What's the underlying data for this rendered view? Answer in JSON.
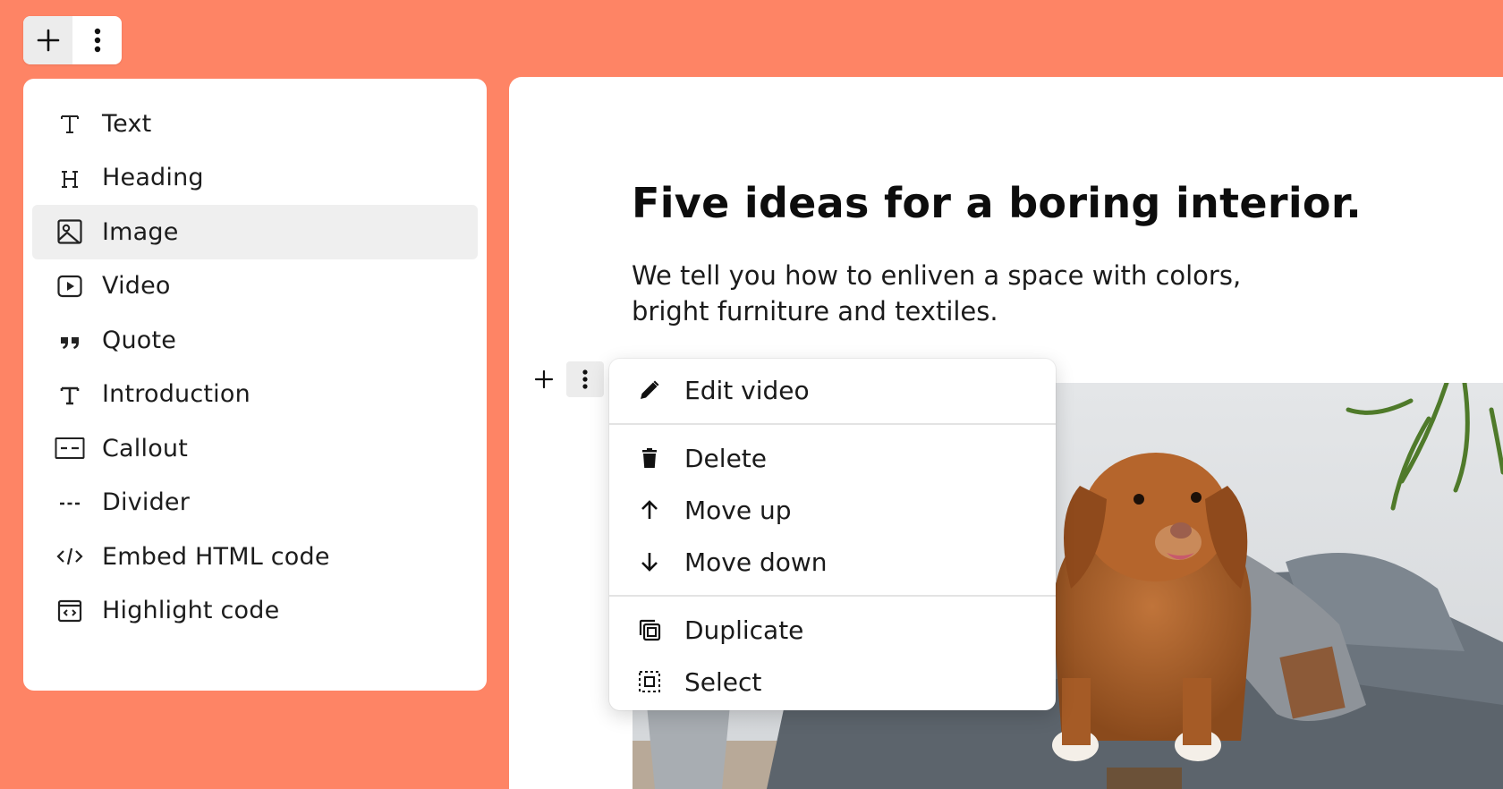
{
  "toolbar": {
    "add_icon": "plus-icon",
    "more_icon": "vertical-dots-icon"
  },
  "block_menu": {
    "items": [
      {
        "label": "Text",
        "icon": "text-icon"
      },
      {
        "label": "Heading",
        "icon": "heading-icon"
      },
      {
        "label": "Image",
        "icon": "image-icon",
        "active": true
      },
      {
        "label": "Video",
        "icon": "video-icon"
      },
      {
        "label": "Quote",
        "icon": "quote-icon"
      },
      {
        "label": "Introduction",
        "icon": "introduction-icon"
      },
      {
        "label": "Callout",
        "icon": "callout-icon"
      },
      {
        "label": "Divider",
        "icon": "divider-icon"
      },
      {
        "label": "Embed HTML code",
        "icon": "embed-code-icon"
      },
      {
        "label": "Highlight code",
        "icon": "highlight-code-icon"
      }
    ]
  },
  "article": {
    "title": "Five ideas for a boring interior.",
    "lead": "We tell you how to enliven a space with colors, bright furniture and textiles."
  },
  "context_menu": {
    "items": [
      {
        "label": "Edit video",
        "icon": "pencil-icon"
      },
      {
        "label": "Delete",
        "icon": "trash-icon"
      },
      {
        "label": "Move up",
        "icon": "arrow-up-icon"
      },
      {
        "label": "Move down",
        "icon": "arrow-down-icon"
      },
      {
        "label": "Duplicate",
        "icon": "duplicate-icon"
      },
      {
        "label": "Select",
        "icon": "select-icon"
      }
    ]
  },
  "colors": {
    "background": "#fe8465",
    "panel": "#ffffff",
    "active_row": "#efefef"
  }
}
